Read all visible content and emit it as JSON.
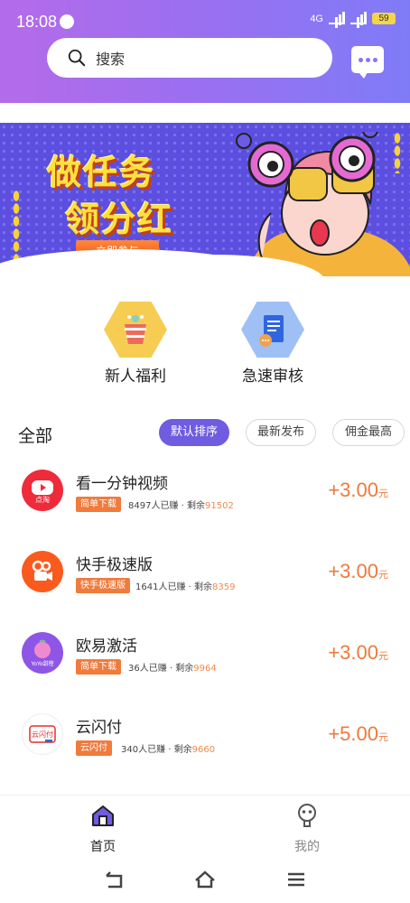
{
  "status_bar": {
    "time": "18:08",
    "network": "4G",
    "battery": "59"
  },
  "search": {
    "placeholder": "搜索"
  },
  "banner": {
    "line1": "做任务",
    "line2": "领分红",
    "cta": "立即参与"
  },
  "quick_entries": [
    {
      "label": "新人福利",
      "icon": "gift-icon"
    },
    {
      "label": "急速审核",
      "icon": "document-icon"
    }
  ],
  "filter": {
    "title": "全部",
    "options": [
      "默认排序",
      "最新发布",
      "佣金最高"
    ],
    "selected": "默认排序"
  },
  "tasks": [
    {
      "name": "看一分钟视频",
      "tag": "简单下载",
      "earned": "8497人已赚",
      "remaining_label": "剩余",
      "remaining": "91502",
      "reward": "+3.00",
      "unit": "元",
      "logo_text": "点淘",
      "logo_color": "#ee2b3b"
    },
    {
      "name": "快手极速版",
      "tag": "快手极速版",
      "earned": "1641人已赚",
      "remaining_label": "剩余",
      "remaining": "8359",
      "reward": "+3.00",
      "unit": "元",
      "logo_text": "",
      "logo_color": "#fb5a1e"
    },
    {
      "name": "欧易激活",
      "tag": "简单下载",
      "earned": "36人已赚",
      "remaining_label": "剩余",
      "remaining": "9964",
      "reward": "+3.00",
      "unit": "元",
      "logo_text": "YoYo甜橙",
      "logo_color": "#8e55e6"
    },
    {
      "name": "云闪付",
      "tag": "云闪付",
      "earned": "340人已赚",
      "remaining_label": "剩余",
      "remaining": "9660",
      "reward": "+5.00",
      "unit": "元",
      "logo_text": "云闪付",
      "logo_color": "#e22f2f"
    }
  ],
  "bottom_nav": [
    {
      "label": "首页",
      "active": true
    },
    {
      "label": "我的",
      "active": false
    }
  ],
  "colors": {
    "accent": "#6f5ce0",
    "reward": "#ee7a3b",
    "tag": "#f07b3c"
  }
}
